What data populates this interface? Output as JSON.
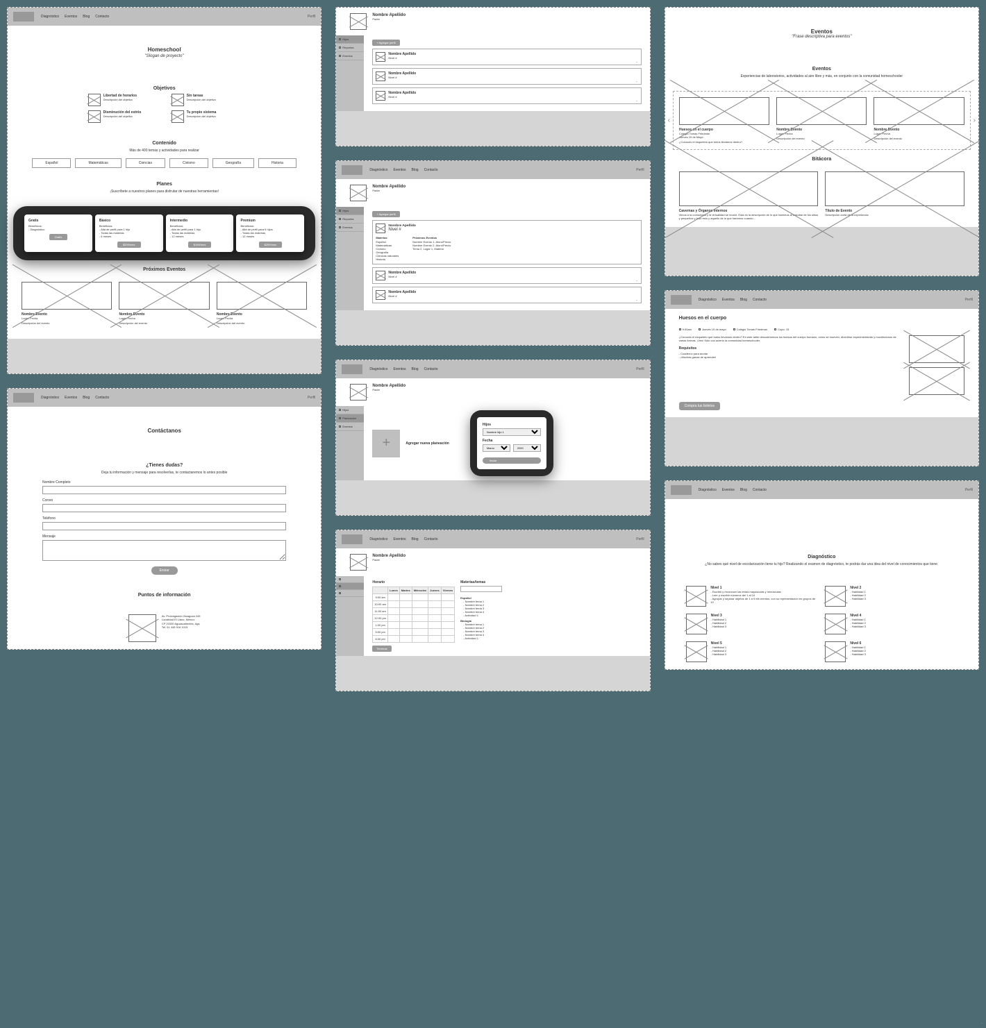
{
  "nav": {
    "links": [
      "Diagnóstico",
      "Eventos",
      "Blog",
      "Contacto"
    ],
    "perfil": "Perfil"
  },
  "home": {
    "hero": {
      "title": "Homeschool",
      "slogan": "\"Slogan de proyecto\""
    },
    "objetivos": {
      "title": "Objetivos",
      "items": [
        {
          "t": "Libertad de horarios",
          "d": "Descripción del objetivo"
        },
        {
          "t": "Sin tareas",
          "d": "Descripción del objetivo"
        },
        {
          "t": "Disminución del estrés",
          "d": "Descripción del objetivo"
        },
        {
          "t": "Tu propio sistema",
          "d": "Descripción del objetivo"
        }
      ]
    },
    "contenido": {
      "title": "Contenido",
      "sub": "Más de 400 temas y actividades para realizar",
      "btns": [
        "Español",
        "Matemáticas",
        "Ciencias",
        "Civismo",
        "Geografía",
        "Historia"
      ]
    },
    "planes": {
      "title": "Planes",
      "sub": "¡Suscríbete a nuestros planes para disfrutar de nuestras herramientas!",
      "items": [
        {
          "t": "Gratis",
          "ben": [
            "Diagnóstico"
          ],
          "btn": "Gratis"
        },
        {
          "t": "Básico",
          "ben": [
            "Alta de perfil para 1 hijo",
            "Todas las materias",
            "6 meses"
          ],
          "btn": "$299/mes"
        },
        {
          "t": "Intermedio",
          "ben": [
            "Alta de perfil para 1 hijo",
            "Todas las materias",
            "12 meses"
          ],
          "btn": "$199/mes"
        },
        {
          "t": "Premium",
          "ben": [
            "Alta de perfil para 6 hijos",
            "Todas las materias",
            "12 meses"
          ],
          "btn": "$299/mes"
        }
      ]
    },
    "eventos": {
      "title": "Próximos Eventos",
      "items": [
        {
          "t": "Nombre Evento",
          "m": "Lugar, Fecha",
          "d": "Descripción del evento"
        },
        {
          "t": "Nombre Evento",
          "m": "Lugar, Fecha",
          "d": "Descripción del evento"
        },
        {
          "t": "Nombre Evento",
          "m": "Lugar, Fecha",
          "d": "Descripción del evento"
        }
      ]
    }
  },
  "contacto": {
    "hero": "Contáctanos",
    "q": "¿Tienes dudas?",
    "sub": "Deja tu información y mensaje para resolverlas, te contactaremos lo antes posible",
    "fields": {
      "nombre": "Nombre Completo",
      "correo": "Correo",
      "tel": "Teléfono",
      "msg": "Mensaje"
    },
    "send": "Enviar",
    "puntos": {
      "title": "Puntos de información",
      "lines": [
        "Av. Prolongación Zaragoza 245",
        "Localidad El Llano, México",
        "CP 20330 Aguascalientes, Ags",
        "Tel. 01 449 916 1015"
      ]
    }
  },
  "perfilPage": {
    "name": "Nombre Apellido",
    "role": "Padre",
    "tabs": [
      "Hijos",
      "Reportes",
      "Eventos"
    ],
    "add": "+ Agregar perfil",
    "child": {
      "name": "Nombre Apellido",
      "lvl": "Nivel #"
    },
    "exp": {
      "materias": {
        "t": "Materias",
        "items": [
          "Español",
          "Matemáticas",
          "Civismo",
          "Geografía",
          "Ciencias naturales",
          "Historia"
        ]
      },
      "prox": {
        "t": "Próximos Eventos",
        "items": [
          "Nombre Evento 1, Aforo/Precio",
          "Nombre Evento 2, Aforo/Precio",
          "Tema 2, Lugar 1, Materia"
        ]
      }
    }
  },
  "planeacion": {
    "tabs": [
      "Hijos",
      "Planeación",
      "Eventos"
    ],
    "addTitle": "Agregar nueva planeación",
    "addSub": "",
    "modal": {
      "t1": "Hijos",
      "opt1": "Nombre hijo 1",
      "t2": "Fecha",
      "mes": "Marzo",
      "yr": "2020",
      "btn": "Iniciar"
    }
  },
  "horario": {
    "title": "Horario",
    "days": [
      "Lunes",
      "Martes",
      "Miércoles",
      "Jueves",
      "Viernes"
    ],
    "times": [
      "9:00 am",
      "10:00 am",
      "11:00 am",
      "12:00 pm",
      "1:00 pm",
      "5:00 pm",
      "6:00 pm"
    ],
    "side": {
      "t": "Materias/temas",
      "esp": {
        "t": "Español",
        "items": [
          "Nombre tema 1",
          "Nombre tema 2",
          "Nombre tema 3",
          "Nombre tema 4",
          "Actividad 1"
        ]
      },
      "bio": {
        "t": "Biología",
        "items": [
          "Nombre tema 1",
          "Nombre tema 2",
          "Nombre tema 3",
          "Nombre tema 4",
          "Actividad 1"
        ]
      }
    },
    "term": "Terminar"
  },
  "eventos": {
    "hero": {
      "t": "Eventos",
      "s": "\"Frase descriptiva para eventos\""
    },
    "intro": {
      "t": "Eventos",
      "s": "Experiencias de laboratorios, actividades al aire libre y más, en conjunto con la comunidad homeschooler"
    },
    "carousel": [
      {
        "t": "Huesos en el cuerpo",
        "m": "Colegio Tomas Friedman",
        "m2": "Jueves 19 de Mayo",
        "d": "¿Conoces el esqueleto que todos llevamos dentro?"
      },
      {
        "t": "Nombre Evento",
        "m": "Lugar, Fecha",
        "d": "Descripción del evento"
      },
      {
        "t": "Nombre Evento",
        "m": "Lugar, Fecha",
        "d": "Descripción del evento"
      }
    ],
    "bitacora": {
      "t": "Bitácora",
      "items": [
        {
          "t": "Cavernas y Órganos Internos",
          "d": "Vimos a la comunidad y la virtualidad se reunió. Esta es la descripción de lo que haremos al estudiar de los sitios y pequeños y todo esto y aquello de lo que haremos cuando..."
        },
        {
          "t": "Título de Evento",
          "d": "Descripción corta de la experiencia"
        }
      ]
    }
  },
  "eventoDet": {
    "title": "Huesos en el cuerpo",
    "meta": [
      "9:00am",
      "Jueves 19 de mayo",
      "Colegio Tomas Friedman",
      "Cupo: 15"
    ],
    "desc": "¿Conoces el esqueleto que todos llevamos dentro? En este taller descubriremos los huesos del cuerpo humano, cómo se mueven, divertirse experimentando y moviéndonos de varias formas. ¡Ven!\nSólo con acierto la comunidad homeschooler.",
    "req": {
      "t": "Requisitos",
      "items": [
        "Cuaderno para anotar",
        "¡Muchas ganas de aprender!"
      ]
    },
    "buy": "Compra tus boletos"
  },
  "diag": {
    "hero": {
      "t": "Diagnóstico",
      "s": "¿No sabes qué nivel de escolarización tiene tu hijo? Realizando el examen de diagnóstico, te podrás dar una idea del nivel de conocimientos que tiene."
    },
    "items": [
      {
        "t": "Nivel 1",
        "d": [
          "Escribir y reconocer las letras mayúsculas y minúsculas",
          "Leer y escribir números del 1 al 10",
          "Agrupar y separar objetos de 1 a 9 ele-mentos, con su representación en grupos de 10"
        ]
      },
      {
        "t": "Nivel 2",
        "d": [
          "Habilidad 1",
          "Habilidad 2",
          "Habilidad 3"
        ]
      },
      {
        "t": "Nivel 3",
        "d": [
          "Habilidad 1",
          "Habilidad 2",
          "Habilidad 3"
        ]
      },
      {
        "t": "Nivel 4",
        "d": [
          "Habilidad 1",
          "Habilidad 2",
          "Habilidad 3"
        ]
      },
      {
        "t": "Nivel 5",
        "d": [
          "Habilidad 1",
          "Habilidad 2",
          "Habilidad 3"
        ]
      },
      {
        "t": "Nivel 6",
        "d": [
          "Habilidad 1",
          "Habilidad 2",
          "Habilidad 3"
        ]
      }
    ]
  }
}
